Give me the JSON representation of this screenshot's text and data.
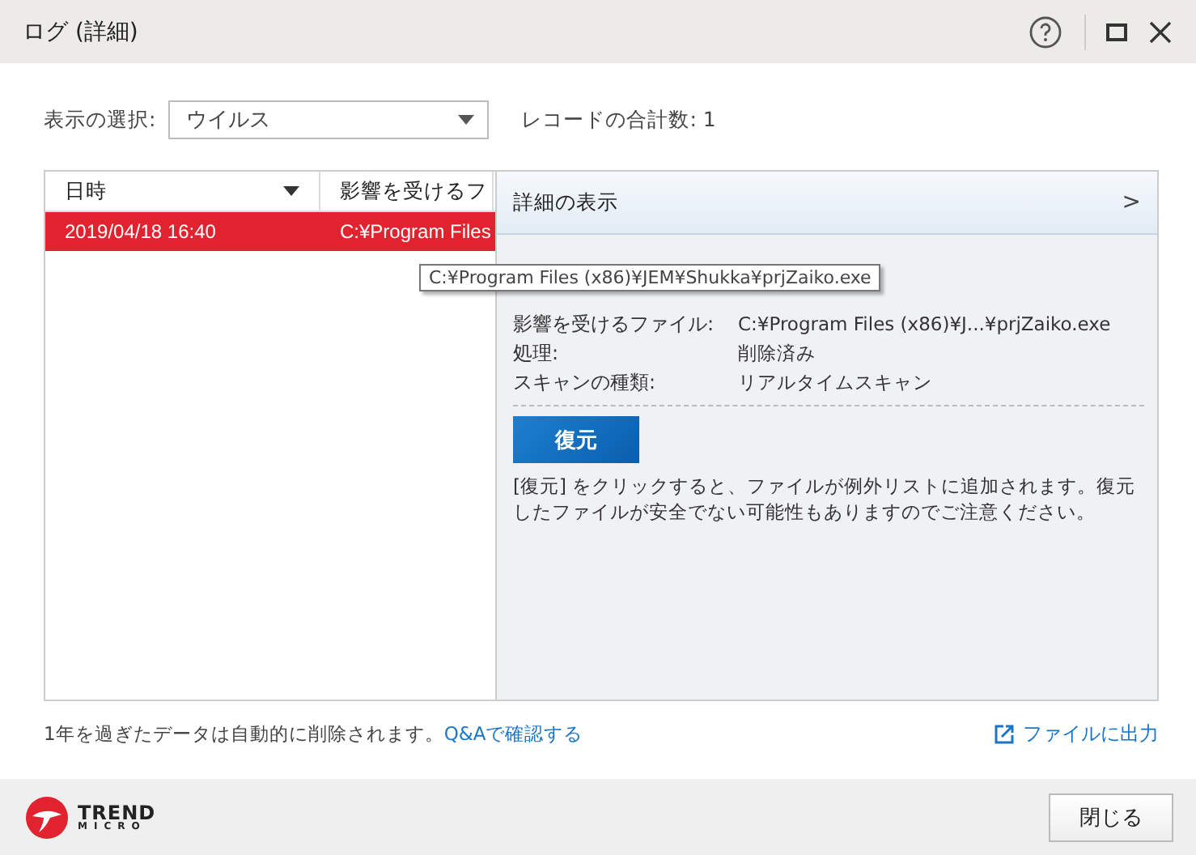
{
  "window": {
    "title": "ログ (詳細)"
  },
  "filter": {
    "label": "表示の選択:",
    "value": "ウイルス",
    "record_count": "レコードの合計数: 1"
  },
  "table": {
    "columns": [
      {
        "label": "日時",
        "sorted": true
      },
      {
        "label": "影響を受けるフ",
        "sorted": false
      }
    ],
    "rows": [
      {
        "cells": [
          "2019/04/18 16:40",
          "C:¥Program Files"
        ],
        "selected": true
      }
    ]
  },
  "details": {
    "title": "詳細の表示",
    "expand": ">",
    "fields": [
      {
        "label": "影響を受けるファイル:",
        "value": "C:¥Program Files (x86)¥J...¥prjZaiko.exe"
      },
      {
        "label": "処理:",
        "value": "削除済み"
      },
      {
        "label": "スキャンの種類:",
        "value": "リアルタイムスキャン"
      }
    ],
    "restore_button": "復元",
    "note": "[復元] をクリックすると、ファイルが例外リストに追加されます。復元したファイルが安全でない可能性もありますのでご注意ください。"
  },
  "tooltip": "C:¥Program Files (x86)¥JEM¥Shukka¥prjZaiko.exe",
  "footer_note": {
    "text": "1年を過ぎたデータは自動的に削除されます。",
    "link": "Q&Aで確認する"
  },
  "export_link": "ファイルに出力",
  "logo": {
    "line1": "TREND",
    "line2": "MICRO"
  },
  "close_button": "閉じる"
}
